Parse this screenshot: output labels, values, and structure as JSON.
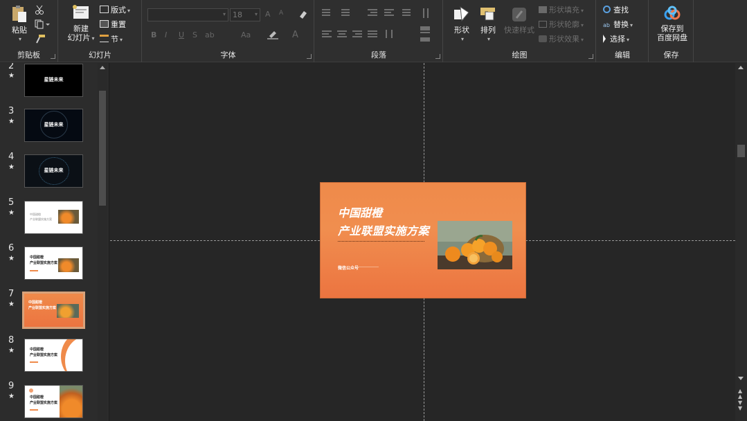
{
  "ribbon": {
    "clipboard": {
      "label": "剪贴板",
      "paste": "粘贴"
    },
    "slides": {
      "label": "幻灯片",
      "new_slide_line1": "新建",
      "new_slide_line2": "幻灯片",
      "layout": "版式",
      "reset": "重置",
      "section": "节"
    },
    "font": {
      "label": "字体",
      "size": "18",
      "bold": "B",
      "italic": "I",
      "underline": "U",
      "strike": "S",
      "spacing": "ab",
      "case": "Aa",
      "grow": "A",
      "shrink": "A",
      "color": "A"
    },
    "paragraph": {
      "label": "段落"
    },
    "drawing": {
      "label": "绘图",
      "shapes": "形状",
      "arrange": "排列",
      "quick_styles": "快速样式",
      "fill": "形状填充",
      "outline": "形状轮廓",
      "effects": "形状效果"
    },
    "editing": {
      "label": "编辑",
      "find": "查找",
      "replace": "替换",
      "select": "选择"
    },
    "save": {
      "label": "保存",
      "btn_line1": "保存到",
      "btn_line2": "百度网盘"
    }
  },
  "slides": [
    {
      "num": "2",
      "star": "★",
      "text": "星链未来"
    },
    {
      "num": "3",
      "star": "★",
      "text": "星链未来"
    },
    {
      "num": "4",
      "star": "★",
      "text": "星链未来"
    },
    {
      "num": "5",
      "star": "★",
      "line1": "中国甜橙",
      "line2": "产业联盟实施方案"
    },
    {
      "num": "6",
      "star": "★",
      "line1": "中国甜橙",
      "line2": "产业联盟实施方案"
    },
    {
      "num": "7",
      "star": "★",
      "line1": "中国甜橙",
      "line2": "产业联盟实施方案"
    },
    {
      "num": "8",
      "star": "★",
      "line1": "中国甜橙",
      "line2": "产业联盟实施方案"
    },
    {
      "num": "9",
      "star": "★",
      "line1": "中国甜橙",
      "line2": "产业联盟实施方案"
    }
  ],
  "slide": {
    "title1": "中国甜橙",
    "title2": "产业联盟实施方案",
    "badge": "微信公众号"
  },
  "colors": {
    "accent": "#ef8a4a",
    "selection": "#d8a27a"
  }
}
